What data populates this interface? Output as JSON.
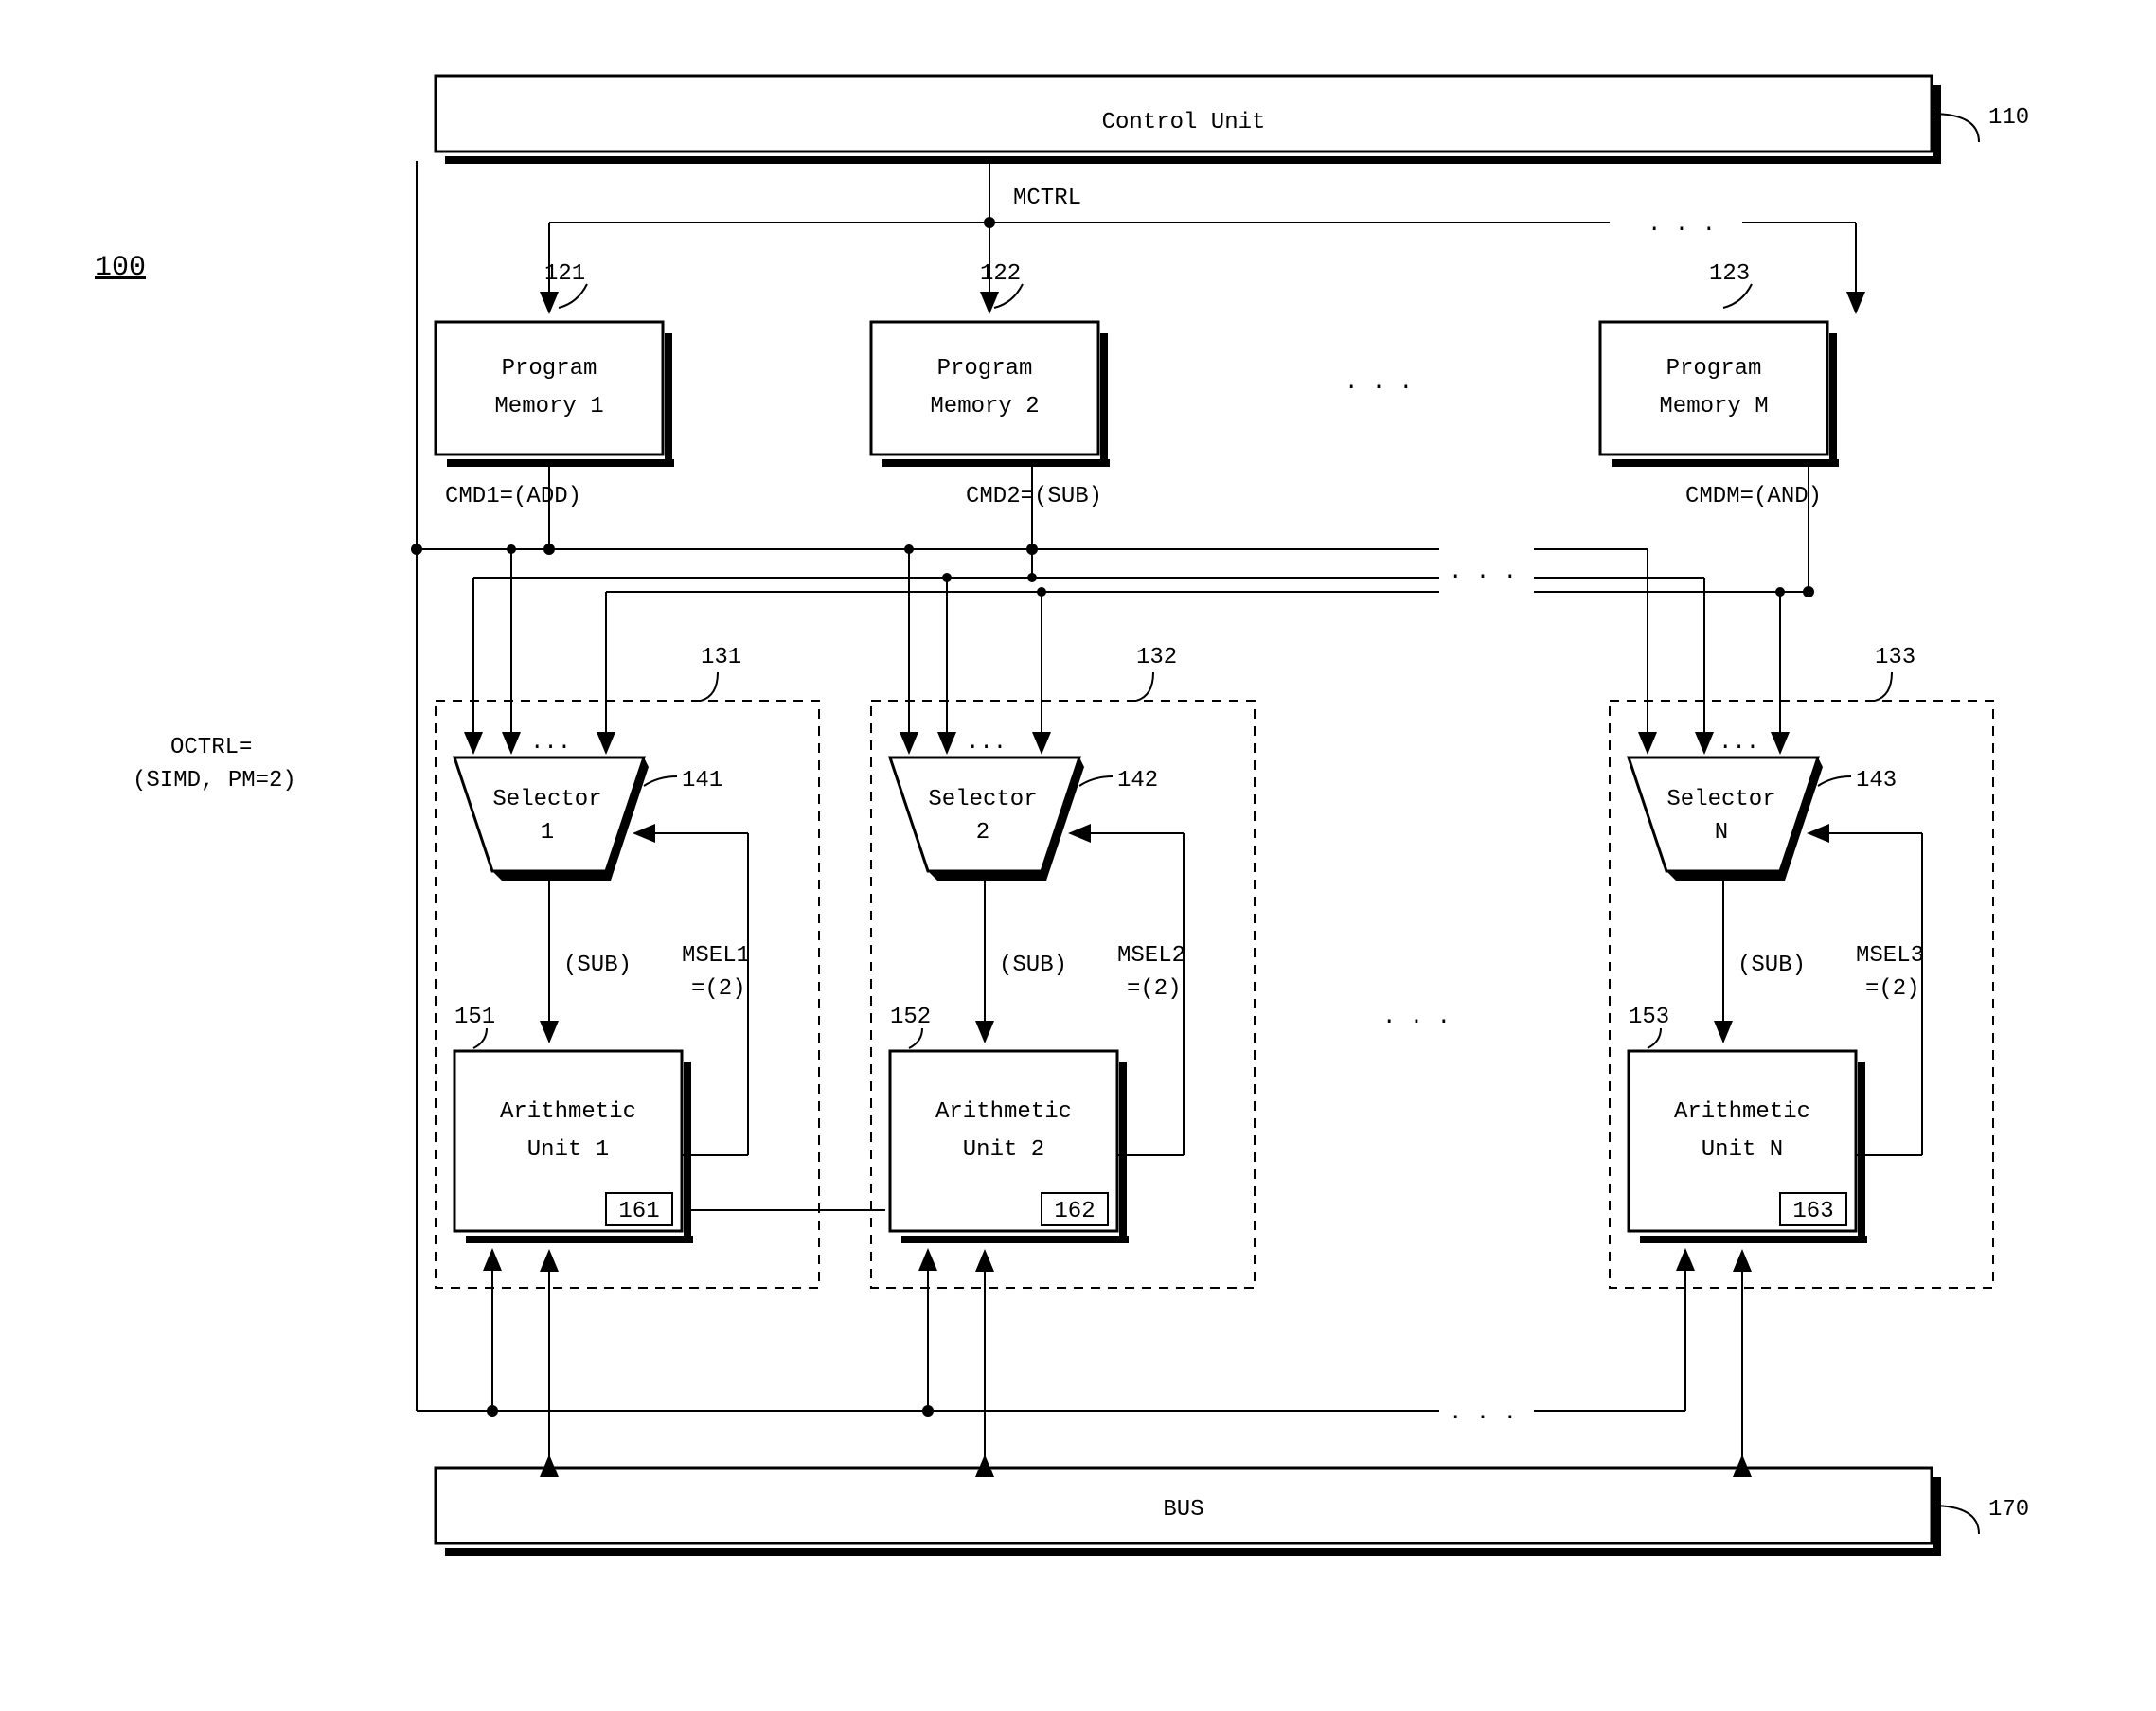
{
  "figure_id": "100",
  "control_unit": {
    "label": "Control Unit",
    "ref": "110",
    "out_signal": "MCTRL"
  },
  "octrl": {
    "label1": "OCTRL=",
    "label2": "(SIMD, PM=2)"
  },
  "program_memories": [
    {
      "line1": "Program",
      "line2": "Memory 1",
      "ref": "121",
      "cmd": "CMD1=(ADD)"
    },
    {
      "line1": "Program",
      "line2": "Memory 2",
      "ref": "122",
      "cmd": "CMD2=(SUB)"
    },
    {
      "line1": "Program",
      "line2": "Memory M",
      "ref": "123",
      "cmd": "CMDM=(AND)"
    }
  ],
  "groups": [
    {
      "ref": "131",
      "selector": {
        "label": "Selector",
        "num": "1",
        "ref": "141"
      },
      "sel_out": "(SUB)",
      "msel": {
        "l1": "MSEL1",
        "l2": "=(2)"
      },
      "arith": {
        "l1": "Arithmetic",
        "l2": "Unit 1",
        "ref": "151",
        "reg": "161"
      }
    },
    {
      "ref": "132",
      "selector": {
        "label": "Selector",
        "num": "2",
        "ref": "142"
      },
      "sel_out": "(SUB)",
      "msel": {
        "l1": "MSEL2",
        "l2": "=(2)"
      },
      "arith": {
        "l1": "Arithmetic",
        "l2": "Unit 2",
        "ref": "152",
        "reg": "162"
      }
    },
    {
      "ref": "133",
      "selector": {
        "label": "Selector",
        "num": "N",
        "ref": "143"
      },
      "sel_out": "(SUB)",
      "msel": {
        "l1": "MSEL3",
        "l2": "=(2)"
      },
      "arith": {
        "l1": "Arithmetic",
        "l2": "Unit N",
        "ref": "153",
        "reg": "163"
      }
    }
  ],
  "bus": {
    "label": "BUS",
    "ref": "170"
  },
  "ellipsis": ". . ."
}
